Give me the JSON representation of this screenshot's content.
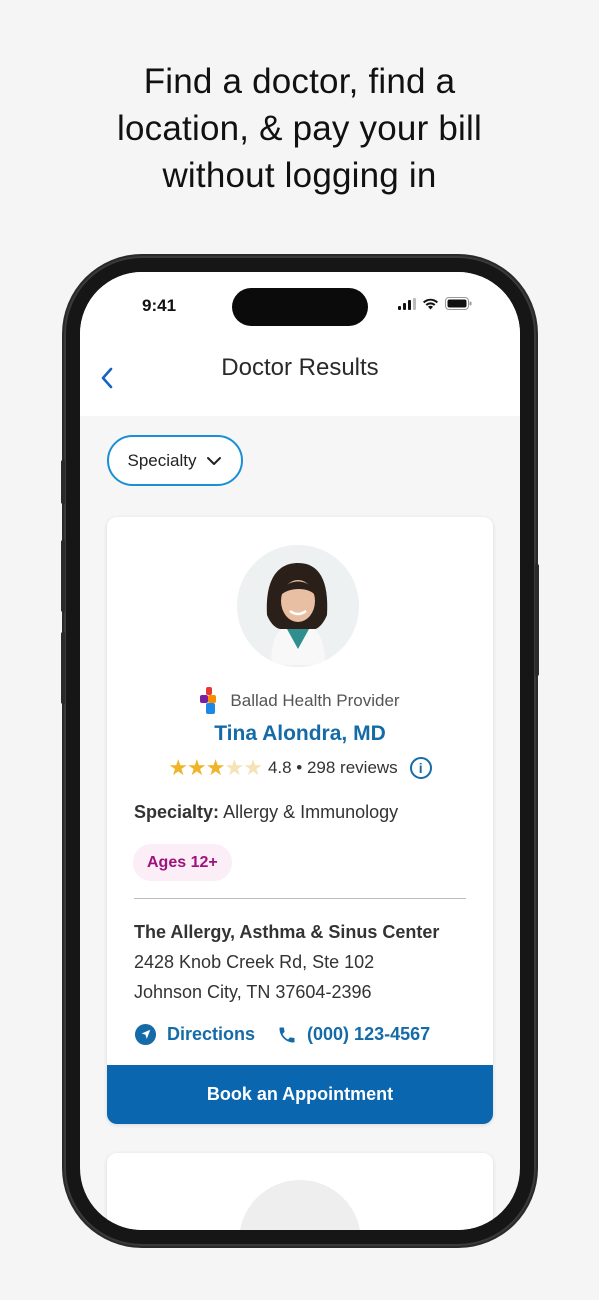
{
  "headline": {
    "line1": "Find a doctor, find a",
    "line2": "location, & pay your bill",
    "line3": "without logging in"
  },
  "status_bar": {
    "time": "9:41"
  },
  "nav": {
    "title": "Doctor Results",
    "back_icon": "chevron-left-icon"
  },
  "filter": {
    "specialty_label": "Specialty"
  },
  "doctor_card": {
    "provider_label": "Ballad Health Provider",
    "name": "Tina Alondra, MD",
    "rating": 3,
    "rating_max": 5,
    "rating_text": "4.8 • 298 reviews",
    "specialty_label": "Specialty:",
    "specialty_value": "Allergy & Immunology",
    "ages_badge": "Ages 12+",
    "location_name": "The Allergy, Asthma & Sinus Center",
    "address_line1": "2428 Knob Creek Rd, Ste 102",
    "address_line2": "Johnson City, TN 37604-2396",
    "directions_label": "Directions",
    "phone": "(000) 123-4567",
    "book_label": "Book an Appointment"
  },
  "colors": {
    "accent_blue": "#156ba8",
    "button_blue": "#0b66b0",
    "chip_border": "#1a8fd6",
    "star": "#f0b429",
    "ages_text": "#a0127c",
    "ages_bg": "#fbeef7"
  }
}
